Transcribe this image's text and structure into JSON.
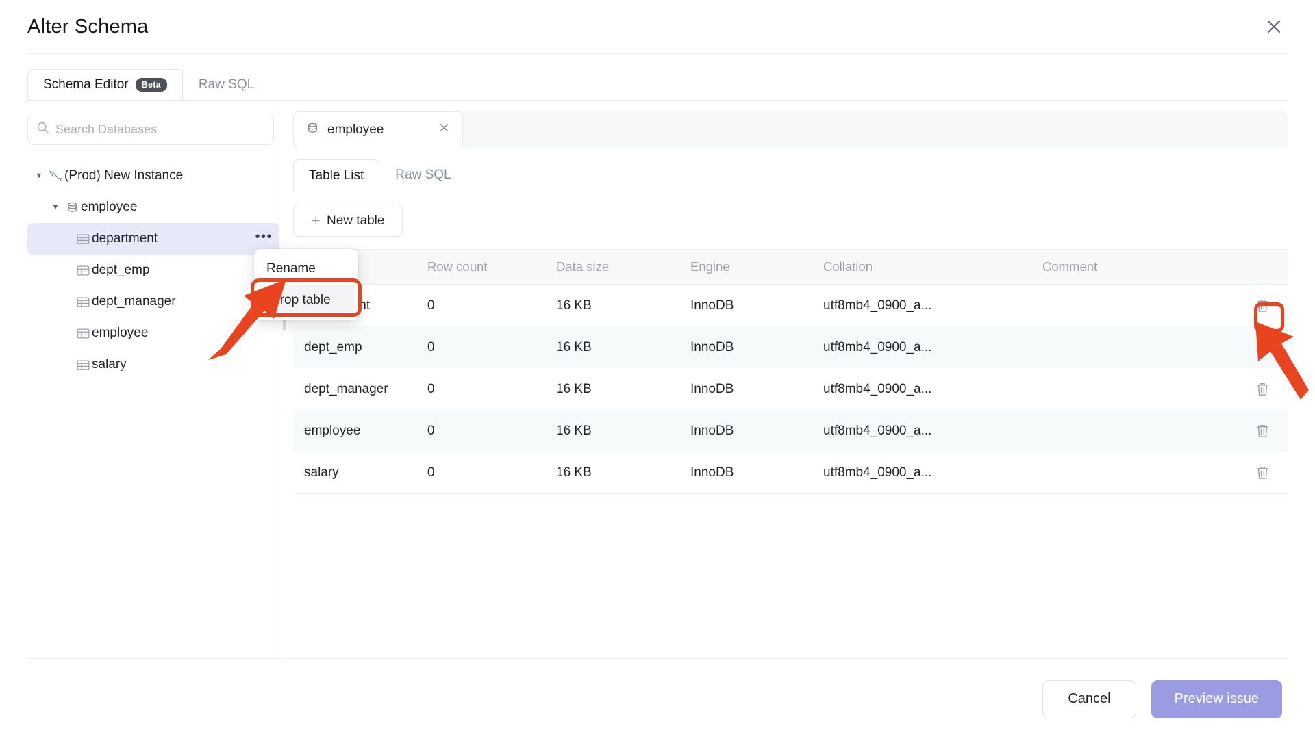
{
  "dialog": {
    "title": "Alter Schema",
    "close_icon": "close-icon"
  },
  "top_tabs": [
    {
      "label": "Schema Editor",
      "badge": "Beta",
      "active": true
    },
    {
      "label": "Raw SQL",
      "badge": "",
      "active": false
    }
  ],
  "sidebar": {
    "search": {
      "placeholder": "Search Databases",
      "value": "",
      "icon": "search-icon"
    },
    "tree": [
      {
        "label": "(Prod) New Instance",
        "level": 0,
        "icon": "mysql-dolphin-icon",
        "expanded": true,
        "selected": false
      },
      {
        "label": "employee",
        "level": 1,
        "icon": "database-icon",
        "expanded": true,
        "selected": false
      },
      {
        "label": "department",
        "level": 2,
        "icon": "table-icon",
        "selected": true,
        "more": "•••"
      },
      {
        "label": "dept_emp",
        "level": 2,
        "icon": "table-icon",
        "selected": false
      },
      {
        "label": "dept_manager",
        "level": 2,
        "icon": "table-icon",
        "selected": false
      },
      {
        "label": "employee",
        "level": 2,
        "icon": "table-icon",
        "selected": false
      },
      {
        "label": "salary",
        "level": 2,
        "icon": "table-icon",
        "selected": false
      }
    ]
  },
  "context_menu": {
    "items": [
      {
        "label": "Rename",
        "highlighted": false
      },
      {
        "label": "Drop table",
        "highlighted": true
      }
    ],
    "highlight_color": "#e8441f"
  },
  "content": {
    "db_chip": {
      "name": "employee",
      "icon": "database-icon",
      "close_icon": "close-icon"
    },
    "inner_tabs": [
      {
        "label": "Table List",
        "active": true
      },
      {
        "label": "Raw SQL",
        "active": false
      }
    ],
    "new_table_button": {
      "label": "New table",
      "icon": "plus-icon"
    },
    "table": {
      "columns": [
        "",
        "Row count",
        "Data size",
        "Engine",
        "Collation",
        "Comment",
        ""
      ],
      "rows": [
        {
          "name": "department",
          "row_count": "0",
          "data_size": "16 KB",
          "engine": "InnoDB",
          "collation": "utf8mb4_0900_a...",
          "comment": "",
          "action_icon": "trash-icon"
        },
        {
          "name": "dept_emp",
          "row_count": "0",
          "data_size": "16 KB",
          "engine": "InnoDB",
          "collation": "utf8mb4_0900_a...",
          "comment": "",
          "action_icon": "trash-icon"
        },
        {
          "name": "dept_manager",
          "row_count": "0",
          "data_size": "16 KB",
          "engine": "InnoDB",
          "collation": "utf8mb4_0900_a...",
          "comment": "",
          "action_icon": "trash-icon"
        },
        {
          "name": "employee",
          "row_count": "0",
          "data_size": "16 KB",
          "engine": "InnoDB",
          "collation": "utf8mb4_0900_a...",
          "comment": "",
          "action_icon": "trash-icon"
        },
        {
          "name": "salary",
          "row_count": "0",
          "data_size": "16 KB",
          "engine": "InnoDB",
          "collation": "utf8mb4_0900_a...",
          "comment": "",
          "action_icon": "trash-icon"
        }
      ]
    }
  },
  "footer": {
    "cancel_label": "Cancel",
    "primary_label": "Preview issue",
    "primary_color": "#9b9be3"
  },
  "annotations": {
    "arrow_color": "#e8441f",
    "arrows": [
      "points-to-drop-table",
      "points-to-first-row-trash-icon"
    ]
  }
}
